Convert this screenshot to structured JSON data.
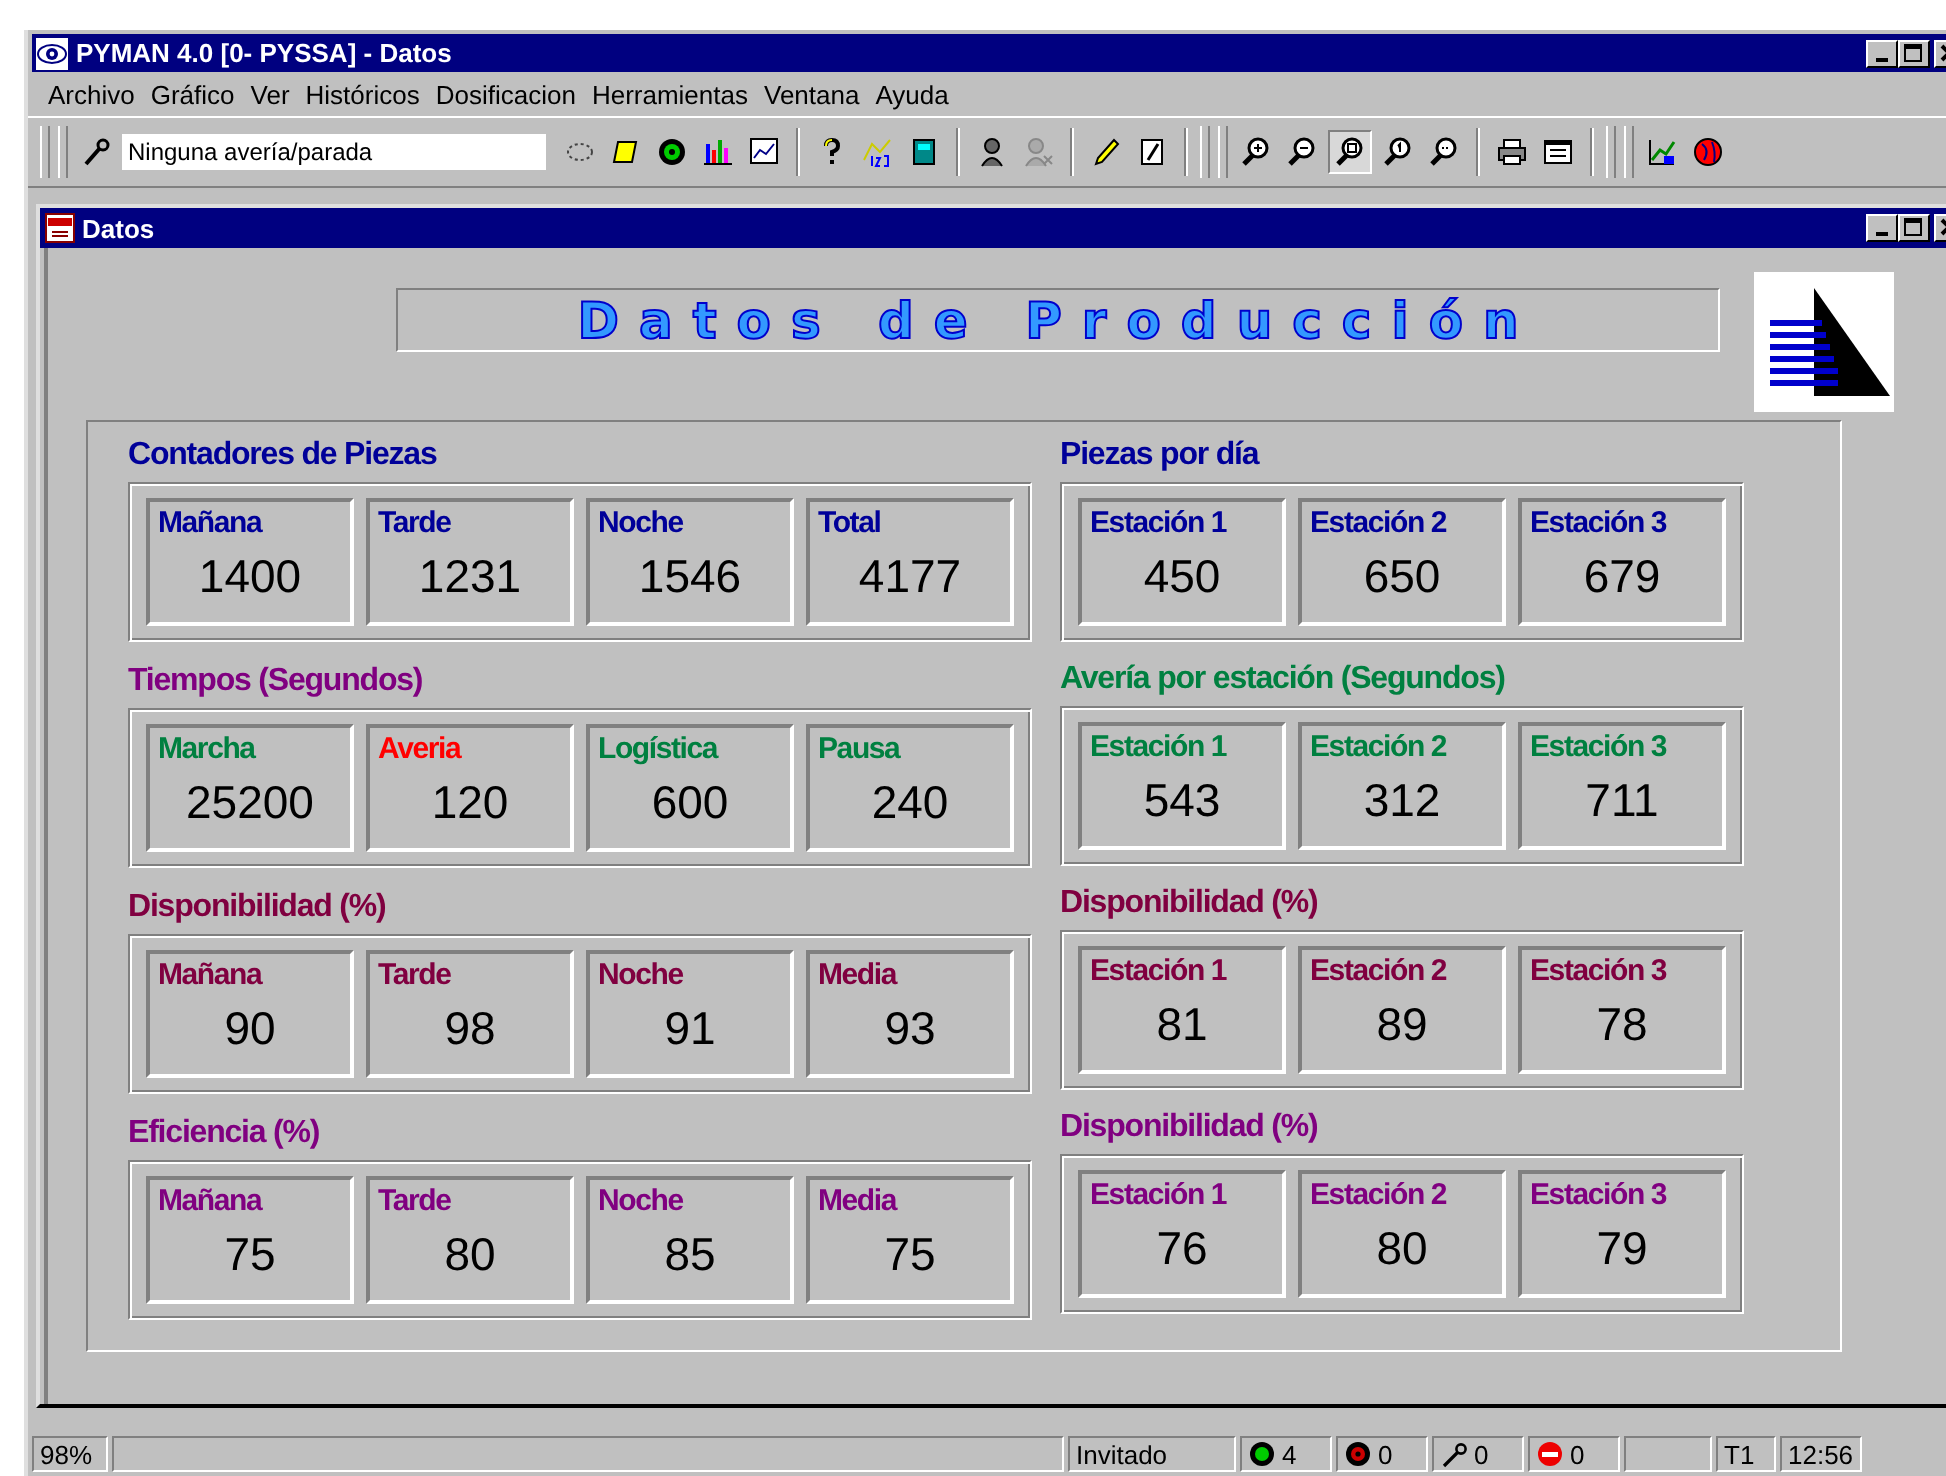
{
  "window": {
    "title": "PYMAN 4.0 [0- PYSSA] - Datos"
  },
  "menu": [
    "Archivo",
    "Gráfico",
    "Ver",
    "Históricos",
    "Dosificacion",
    "Herramientas",
    "Ventana",
    "Ayuda"
  ],
  "toolbar": {
    "status_field": {
      "value": "Ninguna avería/parada"
    }
  },
  "child_window": {
    "title": "Datos",
    "banner": "Datos de Producción",
    "left_column": [
      {
        "title": "Contadores de Piezas",
        "color": "#000099",
        "tiles": [
          {
            "label": "Mañana",
            "value": "1400"
          },
          {
            "label": "Tarde",
            "value": "1231"
          },
          {
            "label": "Noche",
            "value": "1546"
          },
          {
            "label": "Total",
            "value": "4177"
          }
        ]
      },
      {
        "title": "Tiempos (Segundos)",
        "color": "#800080",
        "tiles": [
          {
            "label": "Marcha",
            "value": "25200",
            "color": "#008040"
          },
          {
            "label": "Averia",
            "value": "120",
            "color": "#ff0000"
          },
          {
            "label": "Logística",
            "value": "600",
            "color": "#008040"
          },
          {
            "label": "Pausa",
            "value": "240",
            "color": "#008040"
          }
        ]
      },
      {
        "title": "Disponibilidad (%)",
        "color": "#800040",
        "tiles": [
          {
            "label": "Mañana",
            "value": "90"
          },
          {
            "label": "Tarde",
            "value": "98"
          },
          {
            "label": "Noche",
            "value": "91"
          },
          {
            "label": "Media",
            "value": "93"
          }
        ]
      },
      {
        "title": "Eficiencia (%)",
        "color": "#800080",
        "tiles": [
          {
            "label": "Mañana",
            "value": "75"
          },
          {
            "label": "Tarde",
            "value": "80"
          },
          {
            "label": "Noche",
            "value": "85"
          },
          {
            "label": "Media",
            "value": "75"
          }
        ]
      }
    ],
    "right_column": [
      {
        "title": "Piezas por día",
        "color": "#000099",
        "tiles": [
          {
            "label": "Estación 1",
            "value": "450"
          },
          {
            "label": "Estación 2",
            "value": "650"
          },
          {
            "label": "Estación 3",
            "value": "679"
          }
        ]
      },
      {
        "title": "Avería por estación (Segundos)",
        "color": "#008040",
        "tiles": [
          {
            "label": "Estación 1",
            "value": "543"
          },
          {
            "label": "Estación 2",
            "value": "312"
          },
          {
            "label": "Estación 3",
            "value": "711"
          }
        ]
      },
      {
        "title": "Disponibilidad (%)",
        "color": "#800040",
        "tiles": [
          {
            "label": "Estación 1",
            "value": "81"
          },
          {
            "label": "Estación 2",
            "value": "89"
          },
          {
            "label": "Estación 3",
            "value": "78"
          }
        ]
      },
      {
        "title": "Disponibilidad (%)",
        "color": "#800080",
        "tiles": [
          {
            "label": "Estación 1",
            "value": "76"
          },
          {
            "label": "Estación 2",
            "value": "80"
          },
          {
            "label": "Estación 3",
            "value": "79"
          }
        ]
      }
    ]
  },
  "status_bar": [
    {
      "kind": "text",
      "text": "98%"
    },
    {
      "kind": "blank"
    },
    {
      "kind": "text",
      "text": "Invitado"
    },
    {
      "kind": "running",
      "text": "4"
    },
    {
      "kind": "stopped",
      "text": "0"
    },
    {
      "kind": "repair",
      "text": "0"
    },
    {
      "kind": "halt",
      "text": "0"
    },
    {
      "kind": "blank"
    },
    {
      "kind": "text",
      "text": "T1"
    },
    {
      "kind": "text",
      "text": "12:56"
    }
  ]
}
